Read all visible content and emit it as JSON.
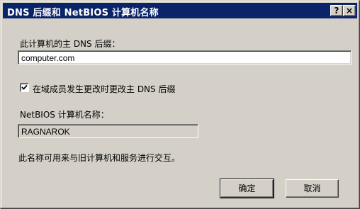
{
  "window": {
    "title": "DNS 后缀和 NetBIOS 计算机名称",
    "help_label": "?",
    "close_label": "×"
  },
  "dns_suffix": {
    "label": "此计算机的主 DNS 后缀：",
    "value": "computer.com"
  },
  "change_option": {
    "label": "在域成员发生更改时更改主 DNS 后缀",
    "checked": true
  },
  "netbios": {
    "label": "NetBIOS 计算机名称：",
    "value": "RAGNAROK"
  },
  "info_text": "此名称可用来与旧计算机和服务进行交互。",
  "buttons": {
    "ok_label": "确定",
    "cancel_label": "取消"
  },
  "colors": {
    "titlebar": "#0a246a",
    "face": "#d4d0c8"
  }
}
